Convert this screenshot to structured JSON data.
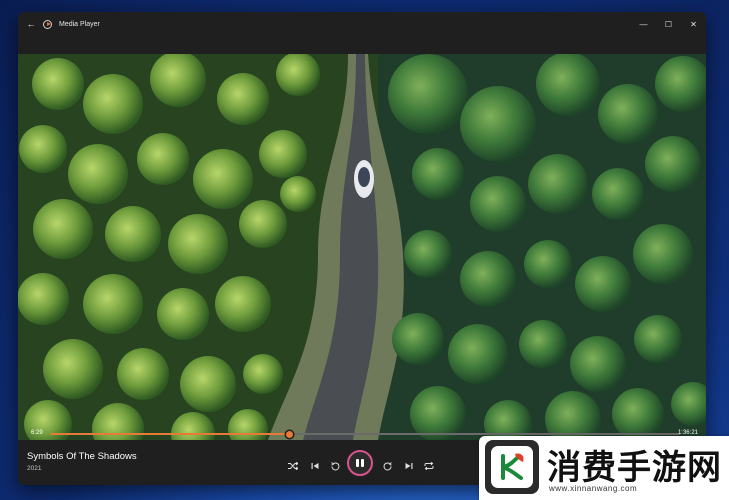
{
  "window": {
    "title": "Media Player",
    "back_icon": "←",
    "minimize_icon": "—",
    "maximize_icon": "☐",
    "close_icon": "✕"
  },
  "player": {
    "elapsed": "6:29",
    "total": "1:36:21",
    "progress_fraction": 0.38,
    "track_title": "Symbols Of The Shadows",
    "track_year": "2021",
    "accent_color": "#e47b37",
    "play_ring_color": "#d9548c"
  },
  "controls": {
    "shuffle_icon": "shuffle-icon",
    "previous_icon": "previous-icon",
    "rewind_icon": "rewind-10-icon",
    "pause_icon": "pause-icon",
    "forward_icon": "forward-30-icon",
    "next_icon": "next-icon",
    "repeat_icon": "repeat-icon"
  },
  "watermark": {
    "text": "消费手游网",
    "url": "www.xinnanwang.com"
  }
}
